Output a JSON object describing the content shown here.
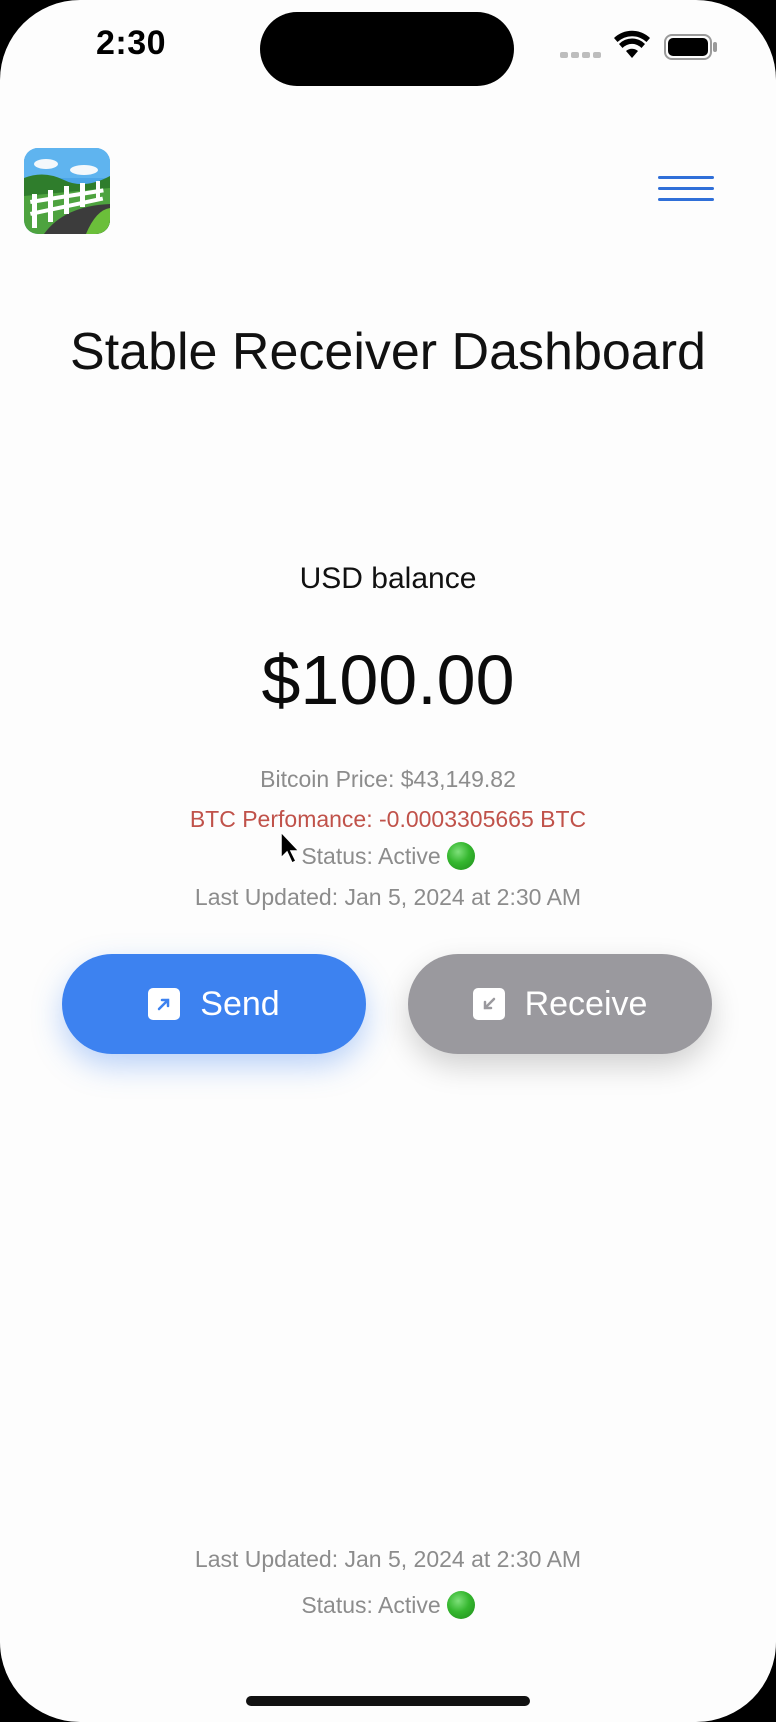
{
  "status_bar": {
    "time": "2:30",
    "icons": [
      "signal-icon",
      "wifi-icon",
      "battery-icon"
    ]
  },
  "header": {
    "app_icon": "fence-landscape-logo",
    "menu_icon": "hamburger-menu-icon"
  },
  "page": {
    "title": "Stable Receiver Dashboard"
  },
  "balance": {
    "label": "USD balance",
    "amount": "$100.00"
  },
  "info": {
    "bitcoin_price": "Bitcoin Price: $43,149.82",
    "btc_performance": "BTC Perfomance: -0.0003305665 BTC",
    "status": "Status: Active",
    "last_updated": "Last Updated: Jan 5, 2024 at 2:30 AM"
  },
  "actions": {
    "send_label": "Send",
    "receive_label": "Receive"
  },
  "footer": {
    "last_updated": "Last Updated: Jan 5, 2024 at 2:30 AM",
    "status": "Status: Active"
  },
  "colors": {
    "accent": "#3d82f0",
    "menu": "#2f6fd8",
    "performance_negative": "#c0524a",
    "receive_button": "#9a999e",
    "status_active": "#35b72f"
  }
}
